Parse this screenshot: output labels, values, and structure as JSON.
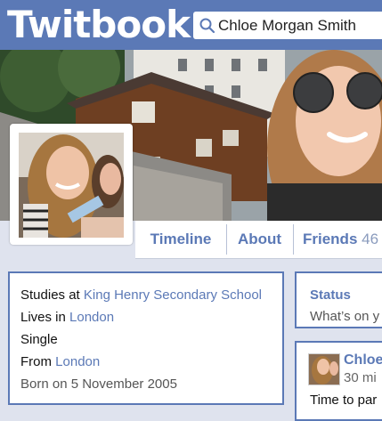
{
  "app": {
    "logo_text": "Twitbook"
  },
  "search": {
    "value": "Chloe Morgan Smith"
  },
  "nav": {
    "tabs": [
      {
        "label": "Timeline"
      },
      {
        "label": "About"
      },
      {
        "label": "Friends",
        "count": "46"
      }
    ]
  },
  "about": {
    "studies_prefix": "Studies at",
    "school": "King Henry Secondary School",
    "lives_prefix": "Lives in",
    "lives_city": "London",
    "relationship": "Single",
    "from_prefix": "From",
    "from_city": "London",
    "born": "Born on 5 November 2005"
  },
  "status": {
    "title": "Status",
    "prompt": "What’s on y"
  },
  "post": {
    "author": "Chloe",
    "time": "30 mi",
    "text": "Time to par"
  },
  "colors": {
    "brand": "#5b79b6",
    "background": "#dfe3ee",
    "card_border": "#5b79b6"
  }
}
